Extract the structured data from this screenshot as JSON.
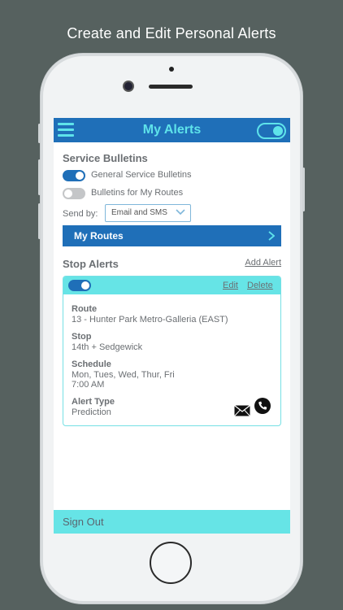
{
  "caption": "Create and Edit Personal Alerts",
  "header": {
    "title": "My Alerts",
    "menu_icon": "hamburger-icon",
    "toggle_state": "on"
  },
  "service_bulletins": {
    "title": "Service Bulletins",
    "toggles": [
      {
        "label": "General Service Bulletins",
        "on": true
      },
      {
        "label": "Bulletins for My Routes",
        "on": false
      }
    ],
    "send_by_label": "Send by:",
    "send_by_value": "Email and SMS",
    "my_routes_label": "My Routes"
  },
  "stop_alerts": {
    "title": "Stop Alerts",
    "add_alert_label": "Add Alert",
    "card": {
      "enabled": true,
      "edit_label": "Edit",
      "delete_label": "Delete",
      "route_label": "Route",
      "route_value": "13 - Hunter Park Metro-Galleria (EAST)",
      "stop_label": "Stop",
      "stop_value": "14th + Sedgewick",
      "schedule_label": "Schedule",
      "schedule_days": "Mon, Tues, Wed, Thur, Fri",
      "schedule_time": "7:00 AM",
      "alert_type_label": "Alert Type",
      "alert_type_value": "Prediction",
      "icons": [
        "mail-icon",
        "phone-icon"
      ]
    }
  },
  "footer": {
    "sign_out_label": "Sign Out"
  },
  "colors": {
    "primary_blue": "#1f6fb8",
    "accent_cyan": "#5ee3ea",
    "card_header": "#66e4e6",
    "background": "#56615f"
  }
}
